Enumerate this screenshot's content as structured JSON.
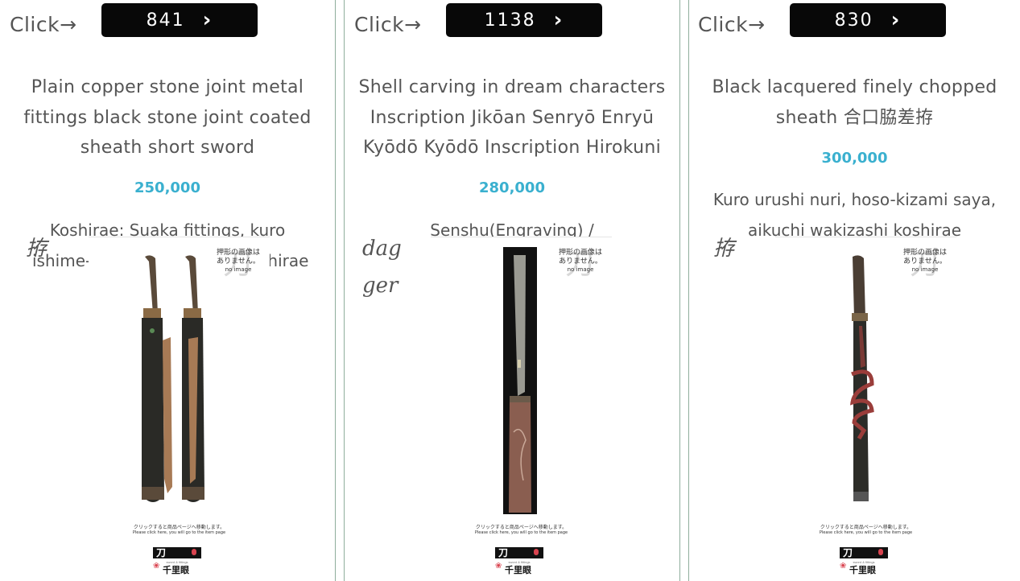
{
  "click_label": "Click→",
  "cards": [
    {
      "number": "841",
      "title_lines": [
        "Plain copper stone joint metal",
        "fittings black stone joint coated",
        "sheath short sword"
      ],
      "price": "250,000",
      "desc_lines": [
        "Koshirae: Suaka fittings, kuro",
        "ishime-",
        "shirae"
      ],
      "image_alt": [
        "拵"
      ],
      "no_image": {
        "jp_line1": "押形の画像は",
        "jp_line2": "ありません。",
        "en": "no image"
      },
      "caption_jp": "クリックすると商品ページへ移動します。",
      "caption_en": "Please click here, you will go to the item page",
      "logo": {
        "mark": "刀",
        "sub": "sword & fittings",
        "brand": "千里眼"
      }
    },
    {
      "number": "1138",
      "title_lines": [
        "Shell carving in dream characters",
        "Inscription Jikōan Senryō Enryū",
        "Kyōdō Kyōdō Inscription Hirokuni"
      ],
      "price": "280,000",
      "desc_lines": [
        "Senshu(Engraving) /"
      ],
      "image_alt": [
        "dag",
        "ger"
      ],
      "no_image": {
        "jp_line1": "押形の画像は",
        "jp_line2": "ありません。",
        "en": "no image"
      },
      "caption_jp": "クリックすると商品ページへ移動します。",
      "caption_en": "Please click here, you will go to the item page",
      "logo": {
        "mark": "刀",
        "sub": "sword & fittings",
        "brand": "千里眼"
      }
    },
    {
      "number": "830",
      "title_lines": [
        "Black lacquered finely chopped",
        "sheath 合口脇差拵"
      ],
      "price": "300,000",
      "desc_lines": [
        "Kuro urushi nuri, hoso-kizami saya,",
        "aikuchi wakizashi koshirae"
      ],
      "image_alt": [
        "拵"
      ],
      "no_image": {
        "jp_line1": "押形の画像は",
        "jp_line2": "ありません。",
        "en": "no image"
      },
      "caption_jp": "クリックすると商品ページへ移動します。",
      "caption_en": "Please click here, you will go to the item page",
      "logo": {
        "mark": "刀",
        "sub": "sword & fittings",
        "brand": "千里眼"
      }
    }
  ]
}
